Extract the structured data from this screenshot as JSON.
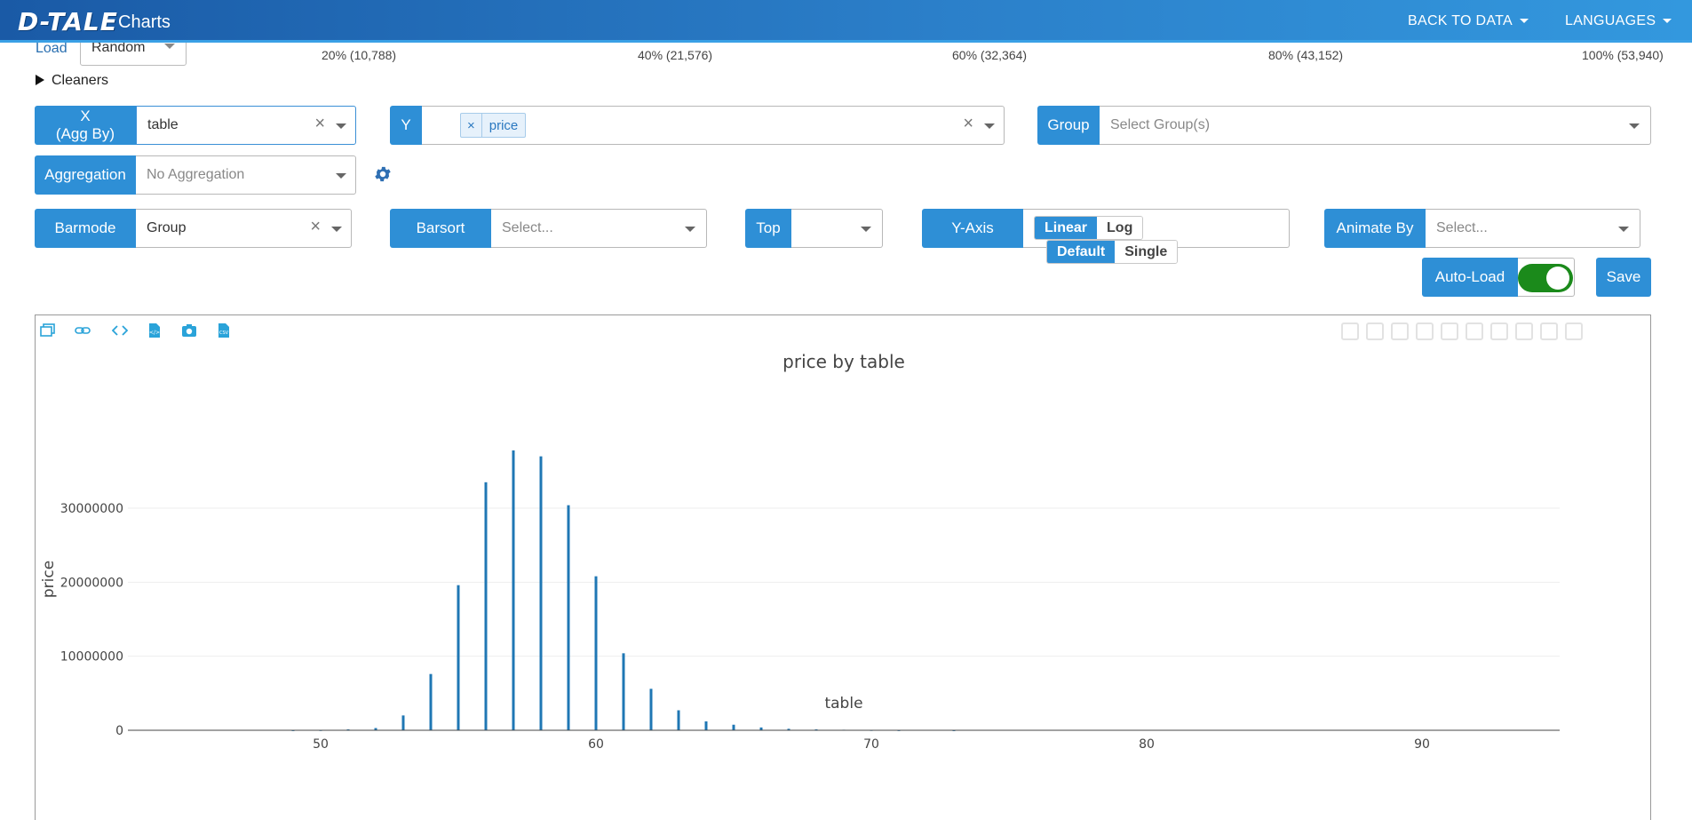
{
  "nav": {
    "logo": "D-TALE",
    "title": "Charts",
    "back_to_data": "BACK TO DATA",
    "languages": "LANGUAGES"
  },
  "load": {
    "label": "Load",
    "value": "Random",
    "progress": [
      "20% (10,788)",
      "40% (21,576)",
      "60% (32,364)",
      "80% (43,152)",
      "100% (53,940)"
    ]
  },
  "cleaners": {
    "label": "Cleaners"
  },
  "controls": {
    "x_label": "X",
    "x_sub": "(Agg By)",
    "x_value": "table",
    "y_label": "Y",
    "y_tag": "price",
    "tag_remove": "×",
    "group_label": "Group",
    "group_placeholder": "Select Group(s)",
    "aggregation_label": "Aggregation",
    "aggregation_placeholder": "No Aggregation",
    "barmode_label": "Barmode",
    "barmode_value": "Group",
    "barsort_label": "Barsort",
    "barsort_placeholder": "Select...",
    "top_label": "Top",
    "yaxis_label": "Y-Axis",
    "yaxis_linear": "Linear",
    "yaxis_log": "Log",
    "yaxis_default": "Default",
    "yaxis_single": "Single",
    "animate_label": "Animate By",
    "animate_placeholder": "Select...",
    "clear": "×",
    "auto_load": "Auto-Load",
    "auto_load_on": true,
    "save": "Save"
  },
  "colors": {
    "accent": "#2e8fd6",
    "bar": "#1f77b4",
    "toggle_on": "#1b8a1b"
  },
  "chart_data": {
    "type": "bar",
    "title": "price by table",
    "xlabel": "table",
    "ylabel": "price",
    "xlim": [
      43,
      95
    ],
    "ylim": [
      0,
      37800000
    ],
    "xticks": [
      50,
      60,
      70,
      80,
      90
    ],
    "yticks": [
      0,
      10000000,
      20000000,
      30000000
    ],
    "ytick_labels": [
      "0",
      "10000000",
      "20000000",
      "30000000"
    ],
    "grid": true,
    "x": [
      49,
      50,
      51,
      52,
      53,
      54,
      55,
      56,
      57,
      58,
      59,
      60,
      61,
      62,
      63,
      64,
      65,
      66,
      67,
      68,
      69,
      70,
      71,
      73
    ],
    "values": [
      15000,
      30000,
      120000,
      300000,
      2000000,
      7600000,
      19600000,
      33500000,
      37800000,
      37000000,
      30400000,
      20800000,
      10400000,
      5600000,
      2700000,
      1200000,
      750000,
      380000,
      200000,
      120000,
      70000,
      40000,
      20000,
      12000
    ]
  }
}
